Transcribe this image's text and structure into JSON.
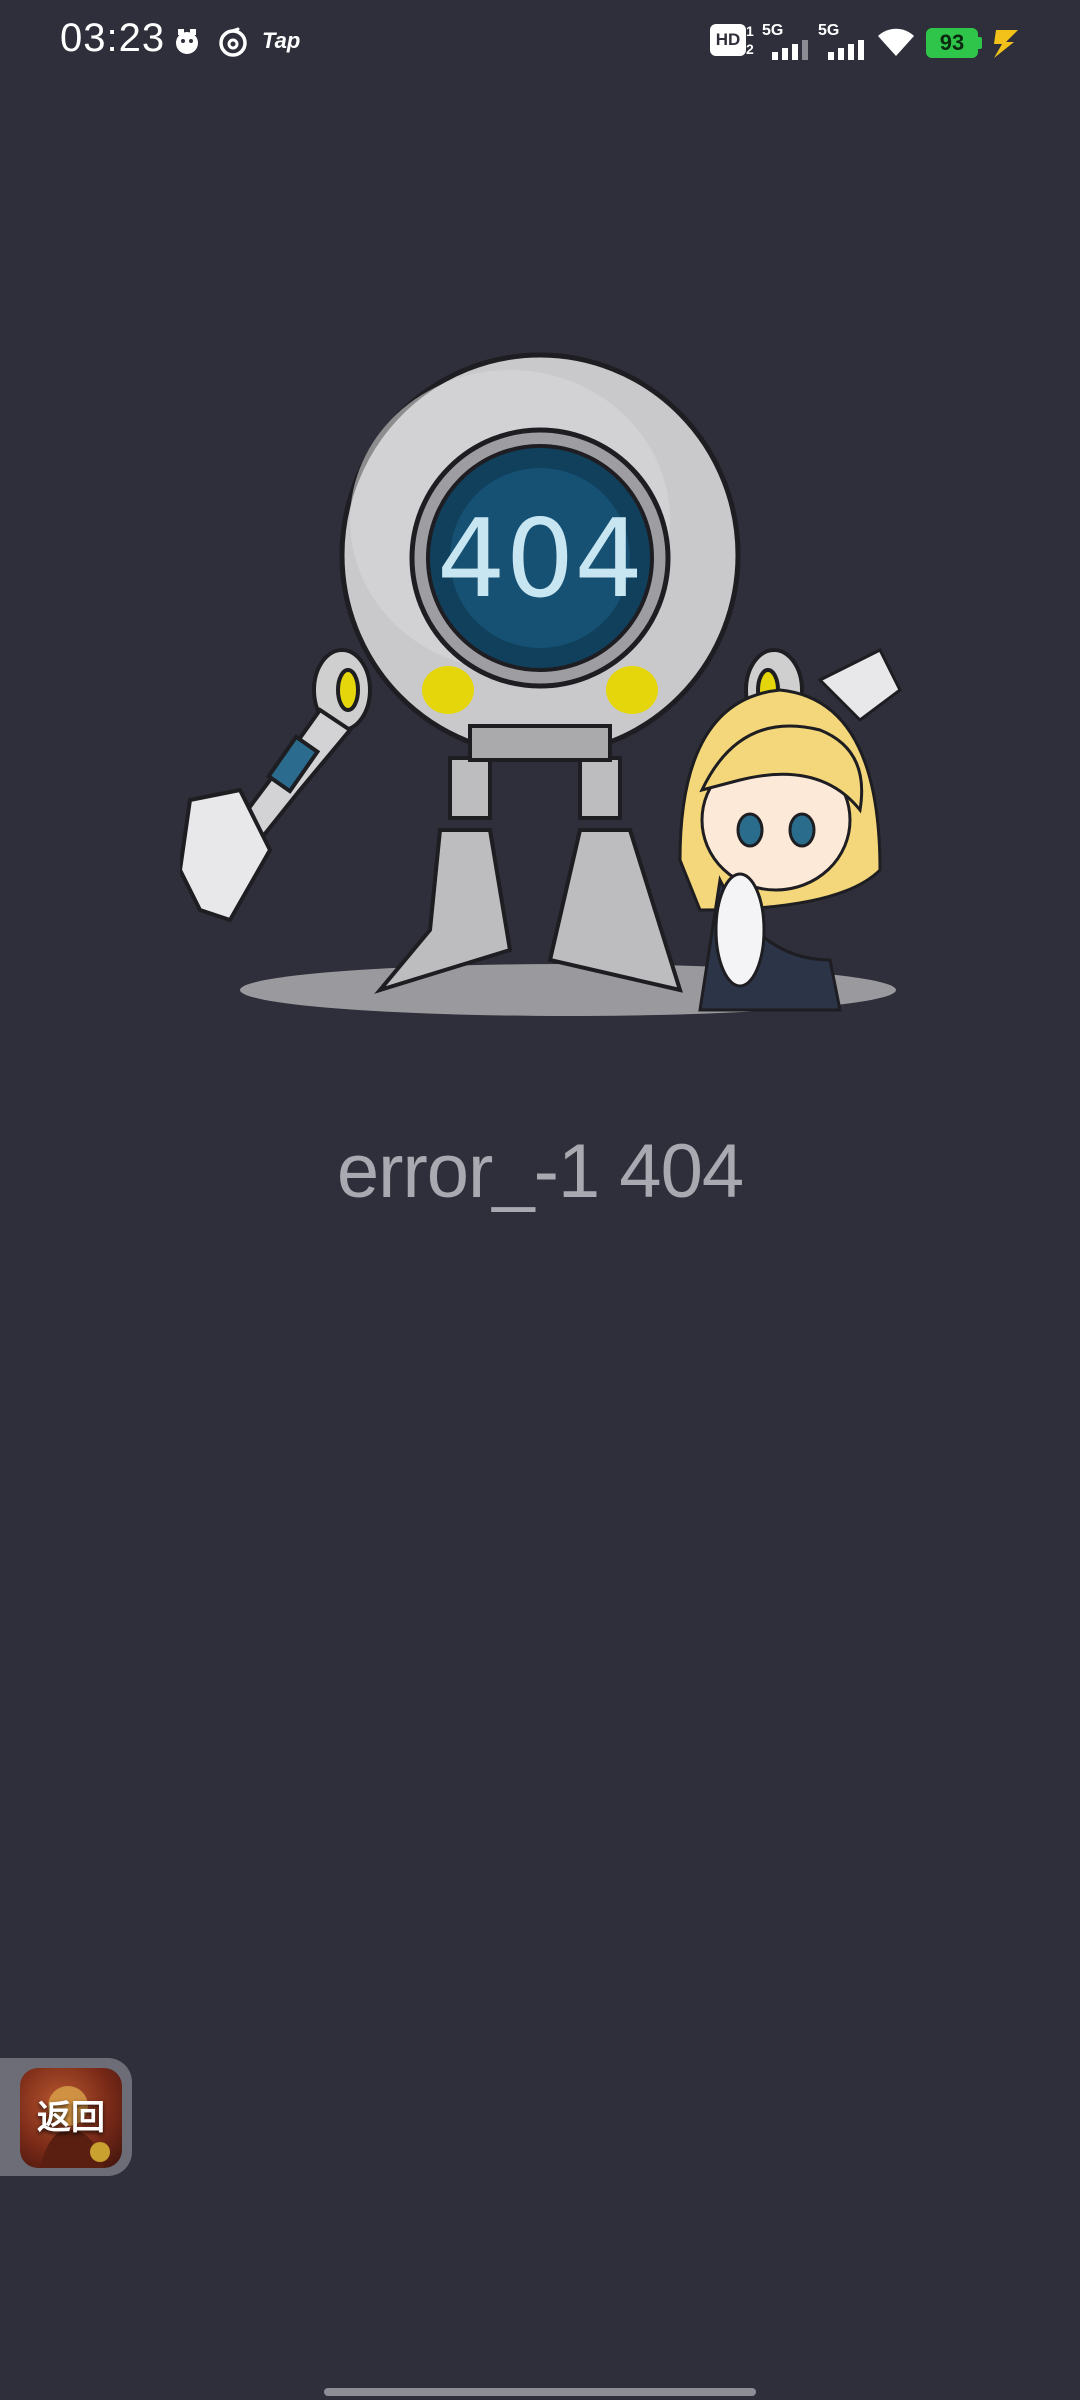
{
  "status_bar": {
    "time": "03:23",
    "tap_label": "Tap",
    "hd_label": "HD",
    "hd_sub_top": "1",
    "hd_sub_bottom": "2",
    "signal1_label": "5G",
    "signal2_label": "5G",
    "battery_level": "93",
    "battery_color": "#2fc54a"
  },
  "illustration": {
    "screen_text": "404",
    "icon": "robot-and-girl-illustration"
  },
  "error": {
    "message": "error_-1 404"
  },
  "back_button": {
    "label": "返回"
  },
  "colors": {
    "background": "#2e2f3a",
    "error_text": "#a9a9b1",
    "accent_yellow": "#e4d60a"
  }
}
